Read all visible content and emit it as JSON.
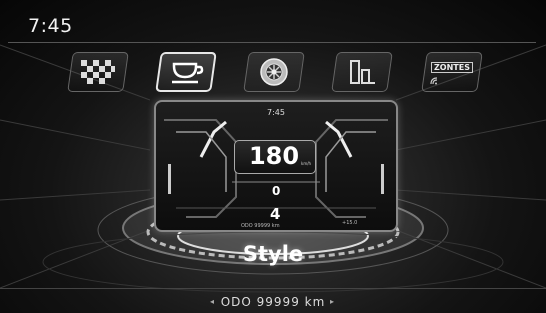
{
  "status": {
    "time": "7:45"
  },
  "menu": {
    "items": [
      {
        "id": "checkered-flag",
        "label": ""
      },
      {
        "id": "cup",
        "label": ""
      },
      {
        "id": "tire",
        "label": ""
      },
      {
        "id": "bars",
        "label": ""
      },
      {
        "id": "zontes",
        "label": "ZONTES"
      }
    ],
    "selected_index": 1
  },
  "preview": {
    "time": "7:45",
    "speed": "180",
    "speed_unit": "km/h",
    "rpm": "0",
    "gear": "4",
    "odo": "ODO 99999 km",
    "temp": "+15.0"
  },
  "theme": {
    "label": "Style"
  },
  "footer": {
    "odo": "ODO 99999 km",
    "prev": "◂",
    "next": "▸"
  }
}
